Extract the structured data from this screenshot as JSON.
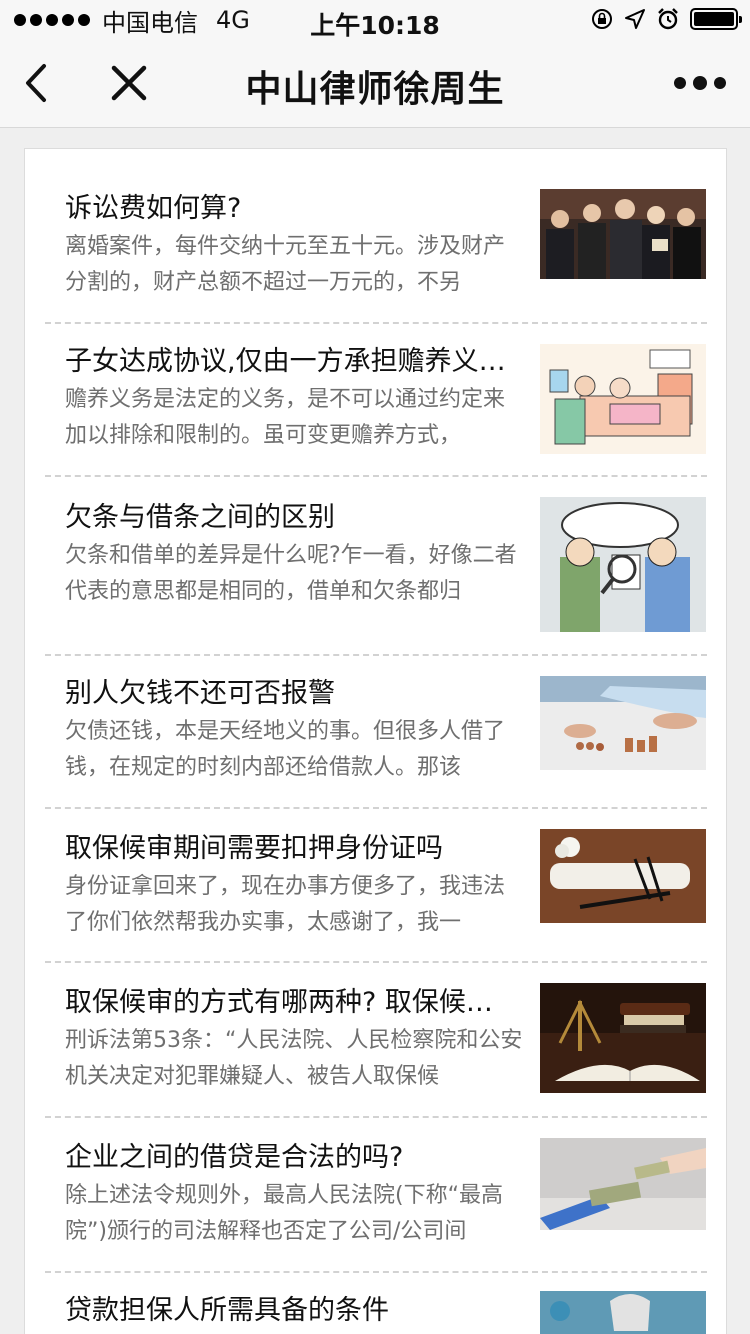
{
  "status_bar": {
    "carrier": "中国电信",
    "network": "4G",
    "time": "上午10:18",
    "icons": [
      "signal-dots-icon",
      "orientation-lock-icon",
      "location-arrow-icon",
      "alarm-icon",
      "battery-icon"
    ]
  },
  "nav": {
    "title": "中山律师徐周生",
    "back_icon": "chevron-left-icon",
    "close_icon": "close-icon",
    "more_icon": "more-dots-icon"
  },
  "articles": [
    {
      "title": "诉讼费如何算?",
      "summary": "离婚案件，每件交纳十元至五十元。涉及财产分割的，财产总额不超过一万元的，不另",
      "thumb": "lawyers-group-photo"
    },
    {
      "title": "子女达成协议,仅由一方承担赡养义…",
      "summary": "赡养义务是法定的义务，是不可以通过约定来加以排除和限制的。虽可变更赡养方式，",
      "thumb": "elderly-care-cartoon"
    },
    {
      "title": "欠条与借条之间的区别",
      "summary": "欠条和借单的差异是什么呢?乍一看，好像二者代表的意思都是相同的，借单和欠条都归",
      "thumb": "iou-magnifier-cartoon"
    },
    {
      "title": "别人欠钱不还可否报警",
      "summary": "欠债还钱，本是天经地义的事。但很多人借了钱，在规定的时刻内部还给借款人。那该",
      "thumb": "counting-coins-photo"
    },
    {
      "title": "取保候审期间需要扣押身份证吗",
      "summary": "身份证拿回来了，现在办事方便多了，我违法了你们依然帮我办实事，太感谢了，我一",
      "thumb": "law-scroll-photo"
    },
    {
      "title": "取保候审的方式有哪两种? 取保候…",
      "summary": "刑诉法第53条：“人民法院、人民检察院和公安机关决定对犯罪嫌疑人、被告人取保候",
      "thumb": "gavel-scales-book-photo"
    },
    {
      "title": "企业之间的借贷是合法的吗?",
      "summary": "除上述法令规则外，最高人民法院(下称“最高院”)颁行的司法解释也否定了公司/公司间",
      "thumb": "money-handover-photo"
    },
    {
      "title": "贷款担保人所需具备的条件",
      "summary": "",
      "thumb": "loan-guarantee-photo"
    }
  ]
}
